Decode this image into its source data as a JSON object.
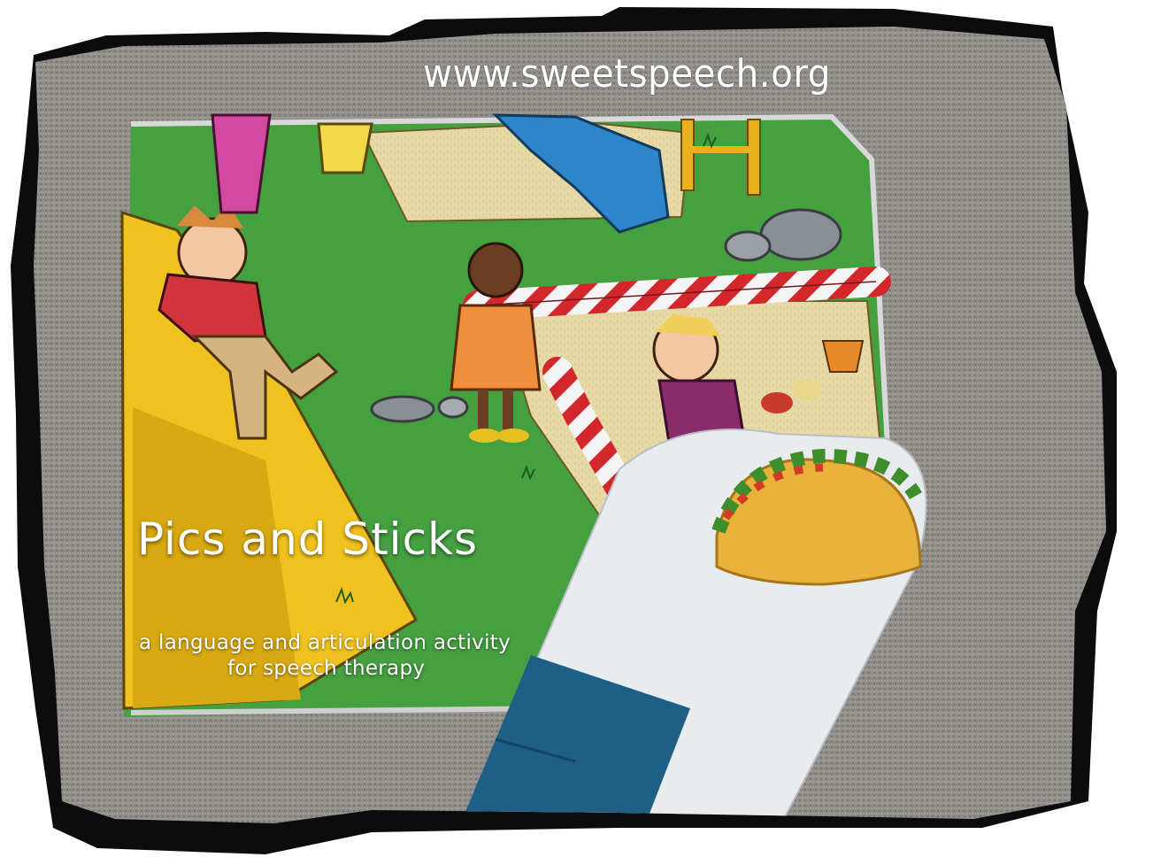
{
  "branding": {
    "url": "www.sweetspeech.org"
  },
  "title": "Pics and Sticks",
  "subtitle": {
    "line1": "a language and articulation activity",
    "line2": "for speech therapy"
  },
  "colors": {
    "frame": "#0c0c0c",
    "board_green": "#3f9a3c",
    "carpet": "#8d8a86",
    "stick_blue": "#1f5f86",
    "card_white": "#e9ecef"
  }
}
